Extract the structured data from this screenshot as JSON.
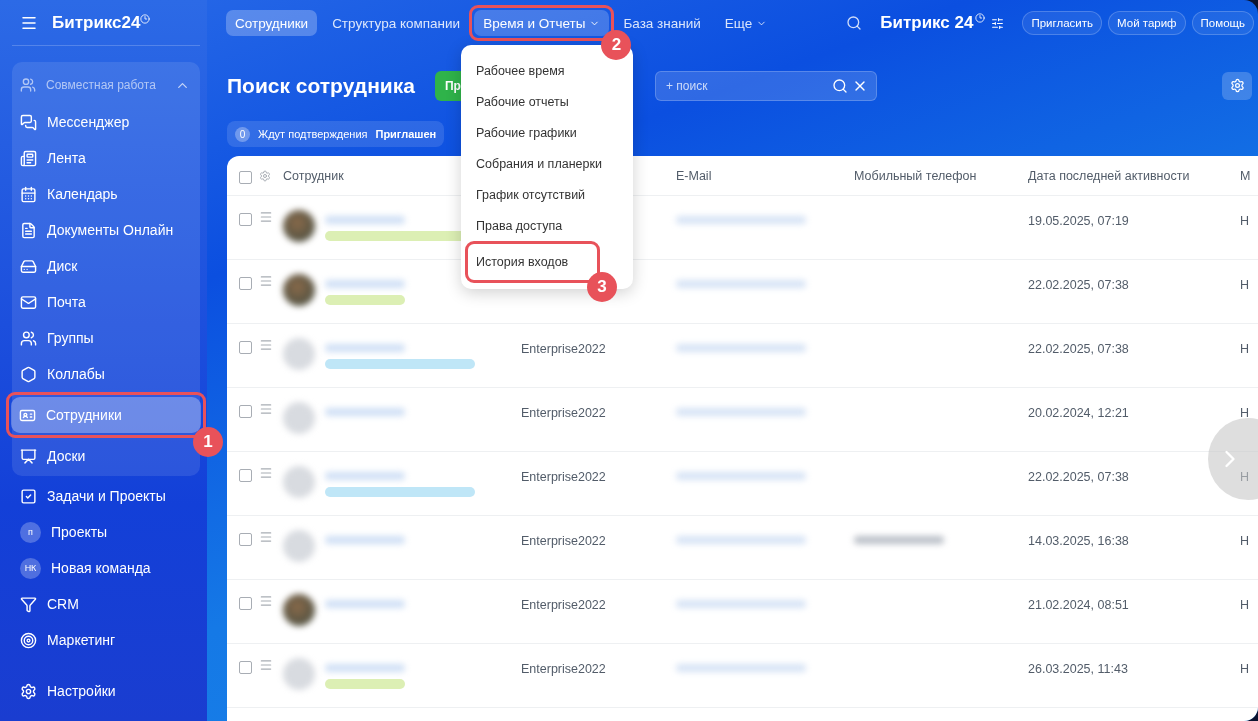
{
  "sidebar": {
    "logo": "Битрикс24",
    "group": {
      "title": "Совместная работа",
      "expanded": true,
      "items": [
        {
          "label": "Мессенджер",
          "selected": false
        },
        {
          "label": "Лента",
          "selected": false
        },
        {
          "label": "Календарь",
          "selected": false
        },
        {
          "label": "Документы Онлайн",
          "selected": false
        },
        {
          "label": "Диск",
          "selected": false
        },
        {
          "label": "Почта",
          "selected": false
        },
        {
          "label": "Группы",
          "selected": false
        },
        {
          "label": "Коллабы",
          "selected": false
        },
        {
          "label": "Сотрудники",
          "selected": true,
          "callout": "1"
        },
        {
          "label": "Доски",
          "selected": false
        }
      ]
    },
    "items": [
      {
        "kind": "icon",
        "label": "Задачи и Проекты"
      },
      {
        "kind": "avatar",
        "avatar_text": "п",
        "label": "Проекты"
      },
      {
        "kind": "avatar",
        "avatar_text": "НК",
        "label": "Новая команда"
      },
      {
        "kind": "icon",
        "label": "CRM"
      },
      {
        "kind": "icon",
        "label": "Маркетинг"
      }
    ],
    "settings": "Настройки"
  },
  "top_tabs": [
    {
      "label": "Сотрудники",
      "selected": true,
      "dropdown": false
    },
    {
      "label": "Структура компании",
      "selected": false,
      "dropdown": false
    },
    {
      "label": "Время и Отчеты",
      "selected": false,
      "dropdown": true,
      "callout": "2"
    },
    {
      "label": "База знаний",
      "selected": false,
      "dropdown": false
    },
    {
      "label": "Еще",
      "selected": false,
      "dropdown": true
    }
  ],
  "top_right": {
    "logo": "Битрикс 24",
    "buttons": [
      "Пригласить",
      "Мой тариф",
      "Помощь"
    ]
  },
  "dropdown_menu": {
    "items": [
      {
        "label": "Рабочее время"
      },
      {
        "label": "Рабочие отчеты"
      },
      {
        "label": "Рабочие графики"
      },
      {
        "label": "Собрания и планерки"
      },
      {
        "label": "График отсутствий"
      },
      {
        "label": "Права доступа"
      },
      {
        "label": "История входов",
        "callout": "3"
      }
    ]
  },
  "page": {
    "title": "Поиск сотрудника",
    "add_button": "Пр",
    "search": {
      "placeholder": "+ поиск"
    },
    "chips": [
      {
        "count": "0",
        "label": "Ждут подтверждения"
      },
      {
        "label": "Приглашен"
      }
    ]
  },
  "table": {
    "select_all": {
      "checked": false
    },
    "columns": [
      "Сотрудник",
      "E-Mail",
      "Мобильный телефон",
      "Дата последней активности",
      "М"
    ],
    "rows": [
      {
        "checked": false,
        "has_photo": true,
        "tag": {
          "color": "#dcefb4"
        },
        "department": "",
        "has_phone": false,
        "date": "19.05.2025, 07:19",
        "column_7": "Н"
      },
      {
        "checked": false,
        "has_photo": true,
        "tag": {
          "color": "#dcefb4"
        },
        "department": "",
        "has_phone": false,
        "date": "22.02.2025, 07:38",
        "column_7": "Н"
      },
      {
        "checked": false,
        "has_photo": false,
        "tag": {
          "color": "#bfe6f7"
        },
        "department": "Enterprise2022",
        "has_phone": false,
        "date": "22.02.2025, 07:38",
        "column_7": "Н"
      },
      {
        "checked": false,
        "has_photo": false,
        "department": "Enterprise2022",
        "has_phone": false,
        "date": "20.02.2024, 12:21",
        "column_7": "Н"
      },
      {
        "checked": false,
        "has_photo": false,
        "tag": {
          "color": "#bfe6f7"
        },
        "department": "Enterprise2022",
        "has_phone": false,
        "date": "22.02.2025, 07:38",
        "column_7": "Н"
      },
      {
        "checked": false,
        "has_photo": false,
        "department": "Enterprise2022",
        "has_phone": true,
        "date": "14.03.2025, 16:38",
        "column_7": "Н"
      },
      {
        "checked": false,
        "has_photo": true,
        "department": "Enterprise2022",
        "has_phone": false,
        "date": "21.02.2024, 08:51",
        "column_7": "Н"
      },
      {
        "checked": false,
        "has_photo": false,
        "tag": {
          "color": "#dcefb4"
        },
        "department": "Enterprise2022",
        "has_phone": false,
        "date": "26.03.2025, 11:43",
        "column_7": "Н"
      }
    ]
  }
}
